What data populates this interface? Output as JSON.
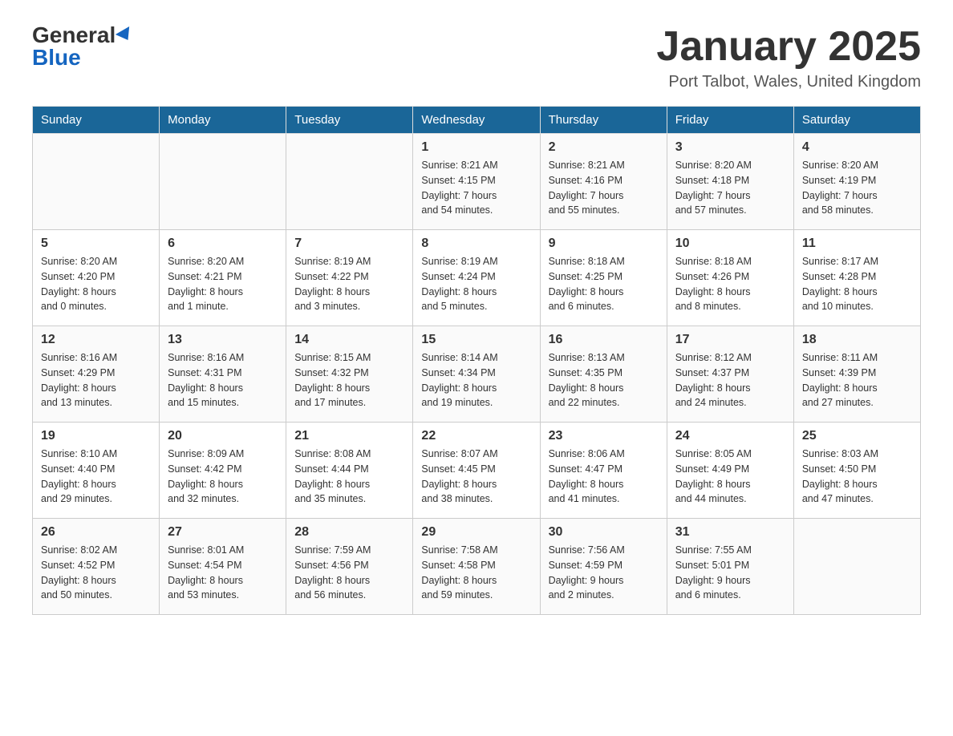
{
  "logo": {
    "general": "General",
    "blue": "Blue"
  },
  "header": {
    "month": "January 2025",
    "location": "Port Talbot, Wales, United Kingdom"
  },
  "days_of_week": [
    "Sunday",
    "Monday",
    "Tuesday",
    "Wednesday",
    "Thursday",
    "Friday",
    "Saturday"
  ],
  "weeks": [
    [
      {
        "day": "",
        "info": ""
      },
      {
        "day": "",
        "info": ""
      },
      {
        "day": "",
        "info": ""
      },
      {
        "day": "1",
        "info": "Sunrise: 8:21 AM\nSunset: 4:15 PM\nDaylight: 7 hours\nand 54 minutes."
      },
      {
        "day": "2",
        "info": "Sunrise: 8:21 AM\nSunset: 4:16 PM\nDaylight: 7 hours\nand 55 minutes."
      },
      {
        "day": "3",
        "info": "Sunrise: 8:20 AM\nSunset: 4:18 PM\nDaylight: 7 hours\nand 57 minutes."
      },
      {
        "day": "4",
        "info": "Sunrise: 8:20 AM\nSunset: 4:19 PM\nDaylight: 7 hours\nand 58 minutes."
      }
    ],
    [
      {
        "day": "5",
        "info": "Sunrise: 8:20 AM\nSunset: 4:20 PM\nDaylight: 8 hours\nand 0 minutes."
      },
      {
        "day": "6",
        "info": "Sunrise: 8:20 AM\nSunset: 4:21 PM\nDaylight: 8 hours\nand 1 minute."
      },
      {
        "day": "7",
        "info": "Sunrise: 8:19 AM\nSunset: 4:22 PM\nDaylight: 8 hours\nand 3 minutes."
      },
      {
        "day": "8",
        "info": "Sunrise: 8:19 AM\nSunset: 4:24 PM\nDaylight: 8 hours\nand 5 minutes."
      },
      {
        "day": "9",
        "info": "Sunrise: 8:18 AM\nSunset: 4:25 PM\nDaylight: 8 hours\nand 6 minutes."
      },
      {
        "day": "10",
        "info": "Sunrise: 8:18 AM\nSunset: 4:26 PM\nDaylight: 8 hours\nand 8 minutes."
      },
      {
        "day": "11",
        "info": "Sunrise: 8:17 AM\nSunset: 4:28 PM\nDaylight: 8 hours\nand 10 minutes."
      }
    ],
    [
      {
        "day": "12",
        "info": "Sunrise: 8:16 AM\nSunset: 4:29 PM\nDaylight: 8 hours\nand 13 minutes."
      },
      {
        "day": "13",
        "info": "Sunrise: 8:16 AM\nSunset: 4:31 PM\nDaylight: 8 hours\nand 15 minutes."
      },
      {
        "day": "14",
        "info": "Sunrise: 8:15 AM\nSunset: 4:32 PM\nDaylight: 8 hours\nand 17 minutes."
      },
      {
        "day": "15",
        "info": "Sunrise: 8:14 AM\nSunset: 4:34 PM\nDaylight: 8 hours\nand 19 minutes."
      },
      {
        "day": "16",
        "info": "Sunrise: 8:13 AM\nSunset: 4:35 PM\nDaylight: 8 hours\nand 22 minutes."
      },
      {
        "day": "17",
        "info": "Sunrise: 8:12 AM\nSunset: 4:37 PM\nDaylight: 8 hours\nand 24 minutes."
      },
      {
        "day": "18",
        "info": "Sunrise: 8:11 AM\nSunset: 4:39 PM\nDaylight: 8 hours\nand 27 minutes."
      }
    ],
    [
      {
        "day": "19",
        "info": "Sunrise: 8:10 AM\nSunset: 4:40 PM\nDaylight: 8 hours\nand 29 minutes."
      },
      {
        "day": "20",
        "info": "Sunrise: 8:09 AM\nSunset: 4:42 PM\nDaylight: 8 hours\nand 32 minutes."
      },
      {
        "day": "21",
        "info": "Sunrise: 8:08 AM\nSunset: 4:44 PM\nDaylight: 8 hours\nand 35 minutes."
      },
      {
        "day": "22",
        "info": "Sunrise: 8:07 AM\nSunset: 4:45 PM\nDaylight: 8 hours\nand 38 minutes."
      },
      {
        "day": "23",
        "info": "Sunrise: 8:06 AM\nSunset: 4:47 PM\nDaylight: 8 hours\nand 41 minutes."
      },
      {
        "day": "24",
        "info": "Sunrise: 8:05 AM\nSunset: 4:49 PM\nDaylight: 8 hours\nand 44 minutes."
      },
      {
        "day": "25",
        "info": "Sunrise: 8:03 AM\nSunset: 4:50 PM\nDaylight: 8 hours\nand 47 minutes."
      }
    ],
    [
      {
        "day": "26",
        "info": "Sunrise: 8:02 AM\nSunset: 4:52 PM\nDaylight: 8 hours\nand 50 minutes."
      },
      {
        "day": "27",
        "info": "Sunrise: 8:01 AM\nSunset: 4:54 PM\nDaylight: 8 hours\nand 53 minutes."
      },
      {
        "day": "28",
        "info": "Sunrise: 7:59 AM\nSunset: 4:56 PM\nDaylight: 8 hours\nand 56 minutes."
      },
      {
        "day": "29",
        "info": "Sunrise: 7:58 AM\nSunset: 4:58 PM\nDaylight: 8 hours\nand 59 minutes."
      },
      {
        "day": "30",
        "info": "Sunrise: 7:56 AM\nSunset: 4:59 PM\nDaylight: 9 hours\nand 2 minutes."
      },
      {
        "day": "31",
        "info": "Sunrise: 7:55 AM\nSunset: 5:01 PM\nDaylight: 9 hours\nand 6 minutes."
      },
      {
        "day": "",
        "info": ""
      }
    ]
  ]
}
